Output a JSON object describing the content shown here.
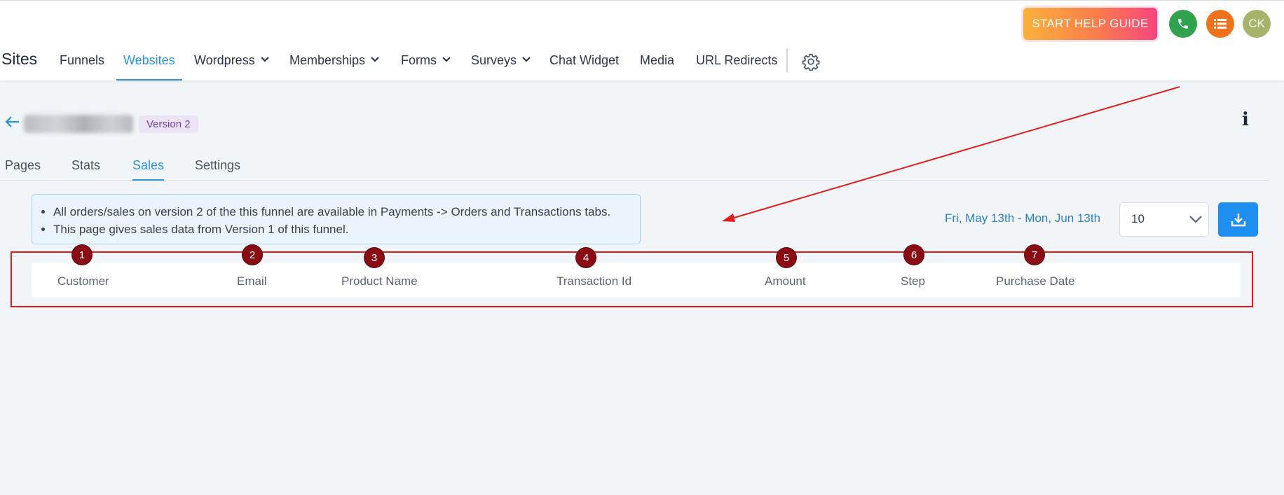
{
  "header": {
    "help_button": "START HELP GUIDE",
    "avatar_initials": "CK"
  },
  "app": {
    "title": "Sites"
  },
  "nav": {
    "items": [
      {
        "label": "Funnels"
      },
      {
        "label": "Websites",
        "active": true
      },
      {
        "label": "Wordpress",
        "has_dropdown": true
      },
      {
        "label": "Memberships",
        "has_dropdown": true
      },
      {
        "label": "Forms",
        "has_dropdown": true
      },
      {
        "label": "Surveys",
        "has_dropdown": true
      },
      {
        "label": "Chat Widget"
      },
      {
        "label": "Media"
      },
      {
        "label": "URL Redirects"
      }
    ]
  },
  "funnel": {
    "version_badge": "Version 2",
    "info_glyph": "i"
  },
  "tabs": [
    {
      "label": "Pages"
    },
    {
      "label": "Stats"
    },
    {
      "label": "Sales",
      "active": true
    },
    {
      "label": "Settings"
    }
  ],
  "notice": {
    "lines": [
      "All orders/sales on version 2 of the this funnel are available in Payments -> Orders and Transactions tabs.",
      "This page gives sales data from Version 1 of this funnel."
    ]
  },
  "filters": {
    "date_range": "Fri, May 13th - Mon, Jun 13th",
    "page_size": "10"
  },
  "table": {
    "columns": [
      "Customer",
      "Email",
      "Product Name",
      "Transaction Id",
      "Amount",
      "Step",
      "Purchase Date"
    ]
  },
  "markers": [
    "1",
    "2",
    "3",
    "4",
    "5",
    "6",
    "7"
  ],
  "colors": {
    "accent": "#2b95d6",
    "annotation_red": "#e21b1b",
    "marker": "#8a0d14",
    "download_button": "#1d8ff0"
  }
}
